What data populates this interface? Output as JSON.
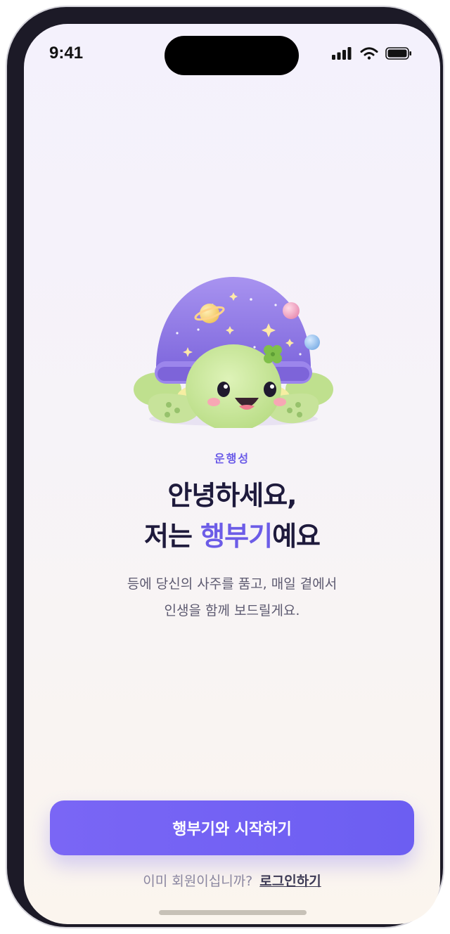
{
  "status_bar": {
    "time": "9:41"
  },
  "brand": {
    "label": "운행성"
  },
  "hero": {
    "title_line1": "안녕하세요,",
    "title_line2_prefix": "저는 ",
    "title_line2_highlight": "행부기",
    "title_line2_suffix": "예요",
    "description_line1": "등에 당신의 사주를 품고, 매일 곁에서",
    "description_line2": "인생을 함께 보드릴게요."
  },
  "actions": {
    "start_label": "행부기와 시작하기",
    "member_question": "이미 회원이십니까?",
    "login_label": "로그인하기"
  },
  "colors": {
    "accent": "#6c5ce7",
    "button": "#6c5ef2",
    "title": "#1e1a3c",
    "shell": "#8f78e6",
    "turtle_body": "#c9e59a"
  },
  "icons": [
    "signal-icon",
    "wifi-icon",
    "battery-icon",
    "turtle-mascot-illustration"
  ]
}
